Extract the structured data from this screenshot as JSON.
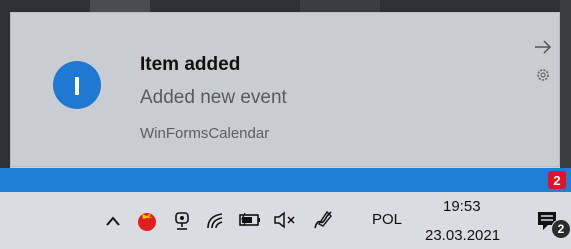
{
  "toast": {
    "title": "Item added",
    "message": "Added new event",
    "app_name": "WinFormsCalendar",
    "icon": "info-icon",
    "icon_color": "#1f78d1"
  },
  "band": {
    "badge_count": "2",
    "color": "#1e7fd6"
  },
  "taskbar": {
    "language": "POL",
    "time": "19:53",
    "date": "23.03.2021",
    "notification_count": "2",
    "tray_icons": [
      "chevron-up-icon",
      "tomato-app-icon",
      "meet-now-icon",
      "wifi-icon",
      "battery-icon",
      "volume-muted-icon",
      "pen-icon"
    ]
  }
}
